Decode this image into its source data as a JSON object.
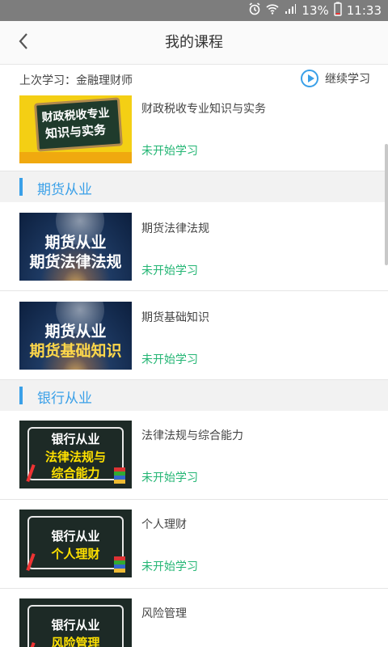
{
  "status_bar": {
    "battery": "13%",
    "time": "11:33"
  },
  "header": {
    "title": "我的课程"
  },
  "last_study": {
    "text": "上次学习：金融理财师",
    "continue_label": "继续学习"
  },
  "courses": [
    {
      "name": "财政税收专业知识与实务",
      "status": "未开始学习",
      "thumb_lines": [
        "财政税收专业",
        "知识与实务"
      ]
    },
    {
      "name": "期货法律法规",
      "status": "未开始学习",
      "thumb_lines": [
        "期货从业",
        "期货法律法规"
      ]
    },
    {
      "name": "期货基础知识",
      "status": "未开始学习",
      "thumb_lines": [
        "期货从业",
        "期货基础知识"
      ]
    },
    {
      "name": "法律法规与综合能力",
      "status": "未开始学习",
      "thumb_lines": [
        "银行从业",
        "法律法规与",
        "综合能力"
      ]
    },
    {
      "name": "个人理财",
      "status": "未开始学习",
      "thumb_lines": [
        "银行从业",
        "个人理财"
      ]
    },
    {
      "name": "风险管理",
      "status": "",
      "thumb_lines": [
        "银行从业",
        "风险管理"
      ]
    }
  ],
  "sections": [
    {
      "label": "期货从业"
    },
    {
      "label": "银行从业"
    }
  ],
  "colors": {
    "accent": "#3aa0e8",
    "status_green": "#22b573",
    "statusbar": "#7d7d7d"
  }
}
